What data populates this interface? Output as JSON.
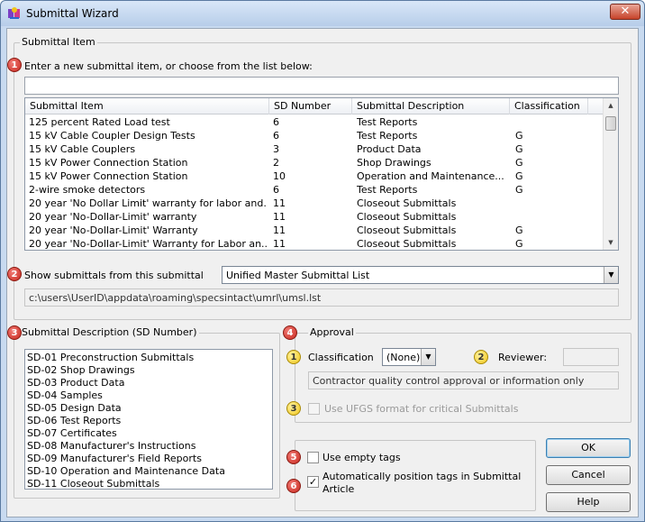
{
  "window": {
    "title": "Submittal Wizard",
    "close_glyph": "✕"
  },
  "submittal_item": {
    "group_title": "Submittal Item",
    "instruction": "Enter a new submittal item, or choose from the list below:",
    "input_value": "",
    "columns": [
      "Submittal Item",
      "SD Number",
      "Submittal Description",
      "Classification"
    ],
    "rows": [
      [
        "125 percent Rated Load test",
        "6",
        "Test Reports",
        ""
      ],
      [
        "15 kV Cable Coupler Design Tests",
        "6",
        "Test Reports",
        "G"
      ],
      [
        "15 kV Cable Couplers",
        "3",
        "Product Data",
        "G"
      ],
      [
        "15 kV Power Connection Station",
        "2",
        "Shop Drawings",
        "G"
      ],
      [
        "15 kV Power Connection Station",
        "10",
        "Operation and Maintenance...",
        "G"
      ],
      [
        "2-wire smoke detectors",
        "6",
        "Test Reports",
        "G"
      ],
      [
        "20 year 'No Dollar Limit' warranty for labor and...",
        "11",
        "Closeout Submittals",
        ""
      ],
      [
        "20 year 'No-Dollar-Limit' warranty",
        "11",
        "Closeout Submittals",
        ""
      ],
      [
        "20 year 'No-Dollar-Limit' Warranty",
        "11",
        "Closeout Submittals",
        "G"
      ],
      [
        "20 year 'No-Dollar-Limit' Warranty for Labor an...",
        "11",
        "Closeout Submittals",
        "G"
      ]
    ],
    "show_from_label": "Show submittals from this submittal",
    "show_from_value": "Unified Master Submittal List",
    "path": "c:\\users\\UserID\\appdata\\roaming\\specsintact\\umrl\\umsl.lst"
  },
  "description": {
    "group_title": "Submittal Description (SD Number)",
    "items": [
      "SD-01 Preconstruction Submittals",
      "SD-02 Shop Drawings",
      "SD-03 Product Data",
      "SD-04 Samples",
      "SD-05 Design Data",
      "SD-06 Test Reports",
      "SD-07 Certificates",
      "SD-08 Manufacturer's Instructions",
      "SD-09 Manufacturer's Field Reports",
      "SD-10 Operation and Maintenance Data",
      "SD-11 Closeout Submittals"
    ]
  },
  "approval": {
    "group_title": "Approval",
    "classification_label": "Classification",
    "classification_value": "(None)",
    "reviewer_label": "Reviewer:",
    "reviewer_value": "",
    "approval_text": "Contractor quality control approval or information only",
    "ufgs_label": "Use UFGS format for critical Submittals"
  },
  "options": {
    "use_empty_tags_label": "Use empty tags",
    "use_empty_tags_checked": false,
    "auto_position_label_line1": "Automatically position tags in Submittal",
    "auto_position_label_line2": "Article",
    "auto_position_checked": true
  },
  "buttons": {
    "ok": "OK",
    "cancel": "Cancel",
    "help": "Help"
  },
  "callouts": {
    "n1": "1",
    "n2": "2",
    "n3": "3",
    "n4": "4",
    "n5": "5",
    "n6": "6"
  },
  "glyphs": {
    "down_arrow": "▼",
    "up_arrow": "▲",
    "check": "✓"
  },
  "colors": {
    "titlebar": "#c8daf0",
    "close": "#c7432a",
    "callout_red": "#c9281e",
    "callout_yellow": "#f0c417"
  }
}
